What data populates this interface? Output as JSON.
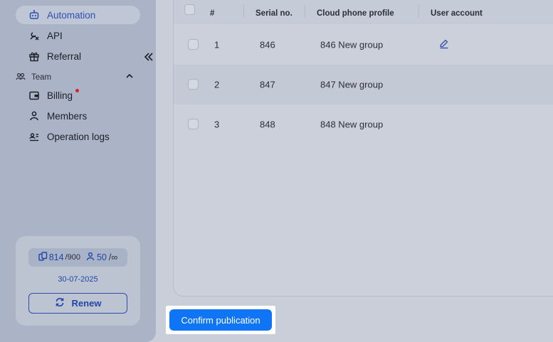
{
  "sidebar": {
    "items": [
      {
        "label": "Automation",
        "icon": "robot-icon",
        "active": true
      },
      {
        "label": "API",
        "icon": "api-tool-icon"
      },
      {
        "label": "Referral",
        "icon": "gift-icon"
      }
    ],
    "team": {
      "label": "Team",
      "items": [
        {
          "label": "Billing",
          "icon": "wallet-icon",
          "has_notification_dot": true
        },
        {
          "label": "Members",
          "icon": "person-icon"
        },
        {
          "label": "Operation logs",
          "icon": "id-card-icon"
        }
      ]
    },
    "plan": {
      "devices_used": "814",
      "devices_total": "/900",
      "members_used": "50",
      "members_total": "/∞",
      "expiry": "30-07-2025",
      "renew_label": "Renew"
    }
  },
  "table": {
    "headers": {
      "index": "#",
      "serial": "Serial no.",
      "profile": "Cloud phone profile",
      "account": "User account"
    },
    "rows": [
      {
        "index": "1",
        "serial": "846",
        "profile": "846 New group",
        "has_edit": true
      },
      {
        "index": "2",
        "serial": "847",
        "profile": "847 New group",
        "has_edit": false
      },
      {
        "index": "3",
        "serial": "848",
        "profile": "848 New group",
        "has_edit": false
      }
    ]
  },
  "footer": {
    "confirm_label": "Confirm publication"
  },
  "colors": {
    "accent": "#0f75f5",
    "link_blue": "#2245a8",
    "dot_red": "#d71f2c"
  }
}
